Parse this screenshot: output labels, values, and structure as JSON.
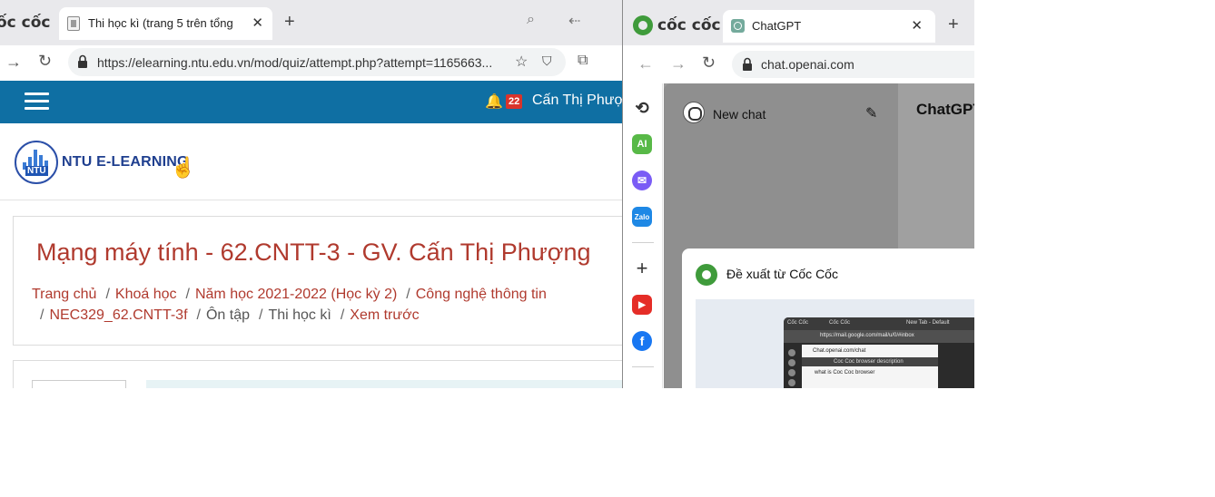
{
  "left_browser": {
    "brand": "ốc cốc",
    "tab": {
      "title": "Thi học kì (trang 5 trên tổng",
      "close": "✕"
    },
    "new_tab": "+",
    "address": {
      "url": "https://elearning.ntu.edu.vn/mod/quiz/attempt.php?attempt=1165663..."
    },
    "header": {
      "notification_count": "22",
      "user_name": "Cấn Thị Phượng"
    },
    "logo": {
      "short": "NTU",
      "name": "NTU E-LEARNING"
    },
    "course": {
      "title": "Mạng máy tính - 62.CNTT-3 - GV. Cấn Thị Phượng",
      "breadcrumb_row1": [
        "Trang chủ",
        "Khoá học",
        "Năm học 2021-2022 (Học kỳ 2)",
        "Công nghệ thông tin"
      ],
      "breadcrumb_row2": [
        "NEC329_62.CNTT-3f",
        "Ôn tập",
        "Thi học kì",
        "Xem trước"
      ]
    }
  },
  "right_browser": {
    "brand": "cốc cốc",
    "tab": {
      "title": "ChatGPT",
      "close": "✕"
    },
    "new_tab": "+",
    "address": {
      "url": "chat.openai.com"
    },
    "sidebar_icons": [
      "history-icon",
      "ai-icon",
      "messenger-icon",
      "zalo-icon",
      "add-icon",
      "youtube-icon",
      "facebook-icon"
    ],
    "sidebar_labels": {
      "ai": "AI",
      "zalo": "Zalo"
    },
    "chat": {
      "new_chat": "New chat",
      "title": "ChatGPT"
    },
    "suggestion": {
      "title": "Đề xuất từ Cốc Cốc",
      "preview": {
        "tabs": [
          "Cốc Cốc",
          "Cốc Cốc",
          "New Tab - Default"
        ],
        "url": "https://mail.google.com/mail/u/0/#inbox",
        "panel_site": "Chat.openai.com/chat",
        "panel_heading": "Coc Coc browser description",
        "panel_question": "what is Coc Coc browser"
      }
    }
  }
}
